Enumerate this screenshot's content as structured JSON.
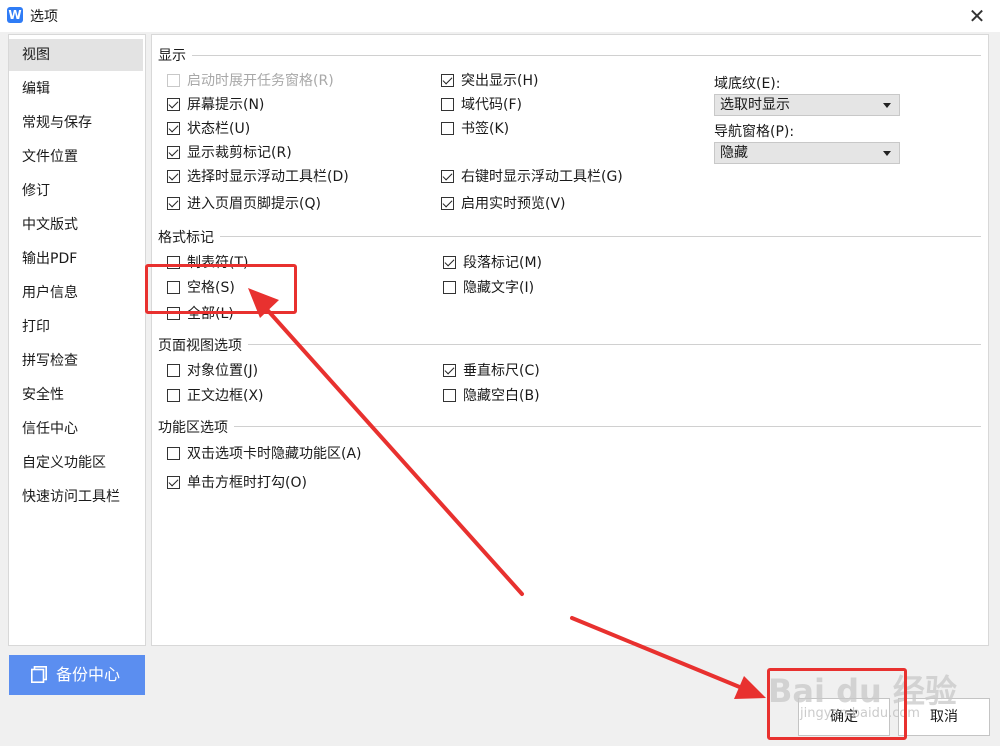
{
  "window": {
    "title": "选项",
    "app_icon_letter": "W"
  },
  "sidebar": {
    "items": [
      {
        "label": "视图",
        "selected": true
      },
      {
        "label": "编辑"
      },
      {
        "label": "常规与保存"
      },
      {
        "label": "文件位置"
      },
      {
        "label": "修订"
      },
      {
        "label": "中文版式"
      },
      {
        "label": "输出PDF"
      },
      {
        "label": "用户信息"
      },
      {
        "label": "打印"
      },
      {
        "label": "拼写检查"
      },
      {
        "label": "安全性"
      },
      {
        "label": "信任中心"
      },
      {
        "label": "自定义功能区"
      },
      {
        "label": "快速访问工具栏"
      }
    ],
    "backup_button": "备份中心"
  },
  "sections": {
    "display": {
      "title": "显示",
      "options": [
        {
          "label": "启动时展开任务窗格(R)",
          "checked": false,
          "disabled": true
        },
        {
          "label": "屏幕提示(N)",
          "checked": true
        },
        {
          "label": "状态栏(U)",
          "checked": true
        },
        {
          "label": "显示裁剪标记(R)",
          "checked": true
        },
        {
          "label": "选择时显示浮动工具栏(D)",
          "checked": true
        },
        {
          "label": "进入页眉页脚提示(Q)",
          "checked": true
        },
        {
          "label": "突出显示(H)",
          "checked": true
        },
        {
          "label": "域代码(F)",
          "checked": false
        },
        {
          "label": "书签(K)",
          "checked": false
        },
        {
          "label": "右键时显示浮动工具栏(G)",
          "checked": true
        },
        {
          "label": "启用实时预览(V)",
          "checked": true
        }
      ],
      "field_shading": {
        "label": "域底纹(E):",
        "value": "选取时显示"
      },
      "nav_pane": {
        "label": "导航窗格(P):",
        "value": "隐藏"
      }
    },
    "format_marks": {
      "title": "格式标记",
      "options": [
        {
          "label": "制表符(T)",
          "checked": false
        },
        {
          "label": "空格(S)",
          "checked": false
        },
        {
          "label": "全部(L)",
          "checked": false
        },
        {
          "label": "段落标记(M)",
          "checked": true
        },
        {
          "label": "隐藏文字(I)",
          "checked": false
        }
      ]
    },
    "page_view": {
      "title": "页面视图选项",
      "options": [
        {
          "label": "对象位置(J)",
          "checked": false
        },
        {
          "label": "正文边框(X)",
          "checked": false
        },
        {
          "label": "垂直标尺(C)",
          "checked": true
        },
        {
          "label": "隐藏空白(B)",
          "checked": false
        }
      ]
    },
    "ribbon": {
      "title": "功能区选项",
      "options": [
        {
          "label": "双击选项卡时隐藏功能区(A)",
          "checked": false
        },
        {
          "label": "单击方框时打勾(O)",
          "checked": true
        }
      ]
    }
  },
  "buttons": {
    "ok": "确定",
    "cancel": "取消"
  },
  "watermark": {
    "main": "Bai du 经验",
    "sub": "jingyan.baidu.com"
  },
  "colors": {
    "accent": "#5b8ef0",
    "annotation": "#e8312f"
  }
}
